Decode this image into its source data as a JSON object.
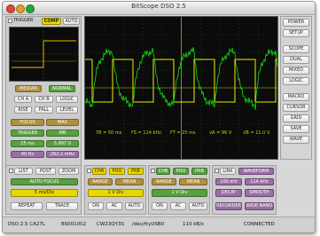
{
  "window": {
    "title": "BitScope DSO 2.5"
  },
  "trigger": {
    "label": "TRIGGER",
    "mode": "COMP",
    "auto": "AUTO"
  },
  "trigger_controls": {
    "median": "MEDIAN",
    "normal": "NORMAL",
    "ch_a": "CH A",
    "ch_b": "CH B",
    "logic": "LOGIC",
    "rise": "RISE",
    "fall": "FALL",
    "level": "LEVEL",
    "focus": "FOCUS",
    "max": "MAX",
    "trigger": "TRIGGER",
    "mb": "MB",
    "ms": "25 ms",
    "volts": "5.997 V",
    "khz": "40 Hz",
    "hz2": "262.2 mHz"
  },
  "timebase": {
    "list": "LIST",
    "post": "POST",
    "zoom": "ZOOM",
    "auto_focus": "AUTO FOCUS",
    "value": "5 ms/Div",
    "repeat": "REPEAT",
    "trace": "TRACE"
  },
  "channel_a": {
    "label": "CHA",
    "poo": "POO",
    "prb": "PRB",
    "range": "RANGE",
    "mean": "MEAN",
    "volts": "1 V Div",
    "on": "ON",
    "ac": "AC",
    "auto": "AUTO"
  },
  "channel_b": {
    "label": "CHB",
    "poo": "POO",
    "prb": "PRB",
    "range": "RANGE",
    "mean": "MEAN",
    "volts": "1 V Div",
    "on": "ON",
    "ac": "AC",
    "auto": "AUTO"
  },
  "link": {
    "label": "LINK",
    "waveform": "WAVEFORM",
    "mv": "100 mV",
    "khz": "114 kHz",
    "decay": "DECAY",
    "smooth": "SMOOTH",
    "recorder": "RECORDER",
    "wide_band": "WIDE BAND"
  },
  "right_buttons": [
    "POWER",
    "SETUP",
    "SCOPE",
    "DUAL",
    "MIXED",
    "LOGIC",
    "MACRO",
    "CURSOR",
    "GRID",
    "SAVE",
    "WAVE"
  ],
  "scope_readouts": {
    "tb": "TB = 50 ms",
    "fs": "FS = 114 kHz",
    "ft": "FT = 25 ms",
    "va": "VA = 96 V",
    "vb": "VB = 11.0 V"
  },
  "status": {
    "model": "DSO 2.5 CA27L",
    "serial": "BS001002",
    "id": "CW23QY3S",
    "device": "/dev/ttyUSB0",
    "rate": "110 kB/s",
    "state": "CONNECTED"
  },
  "colors": {
    "accent_yellow": "#e8d800",
    "trace_green": "#14e014",
    "trace_yellow": "#eeee00",
    "chip_green": "#58a040",
    "chip_gold": "#b09040",
    "chip_purple": "#9a6fa6"
  }
}
